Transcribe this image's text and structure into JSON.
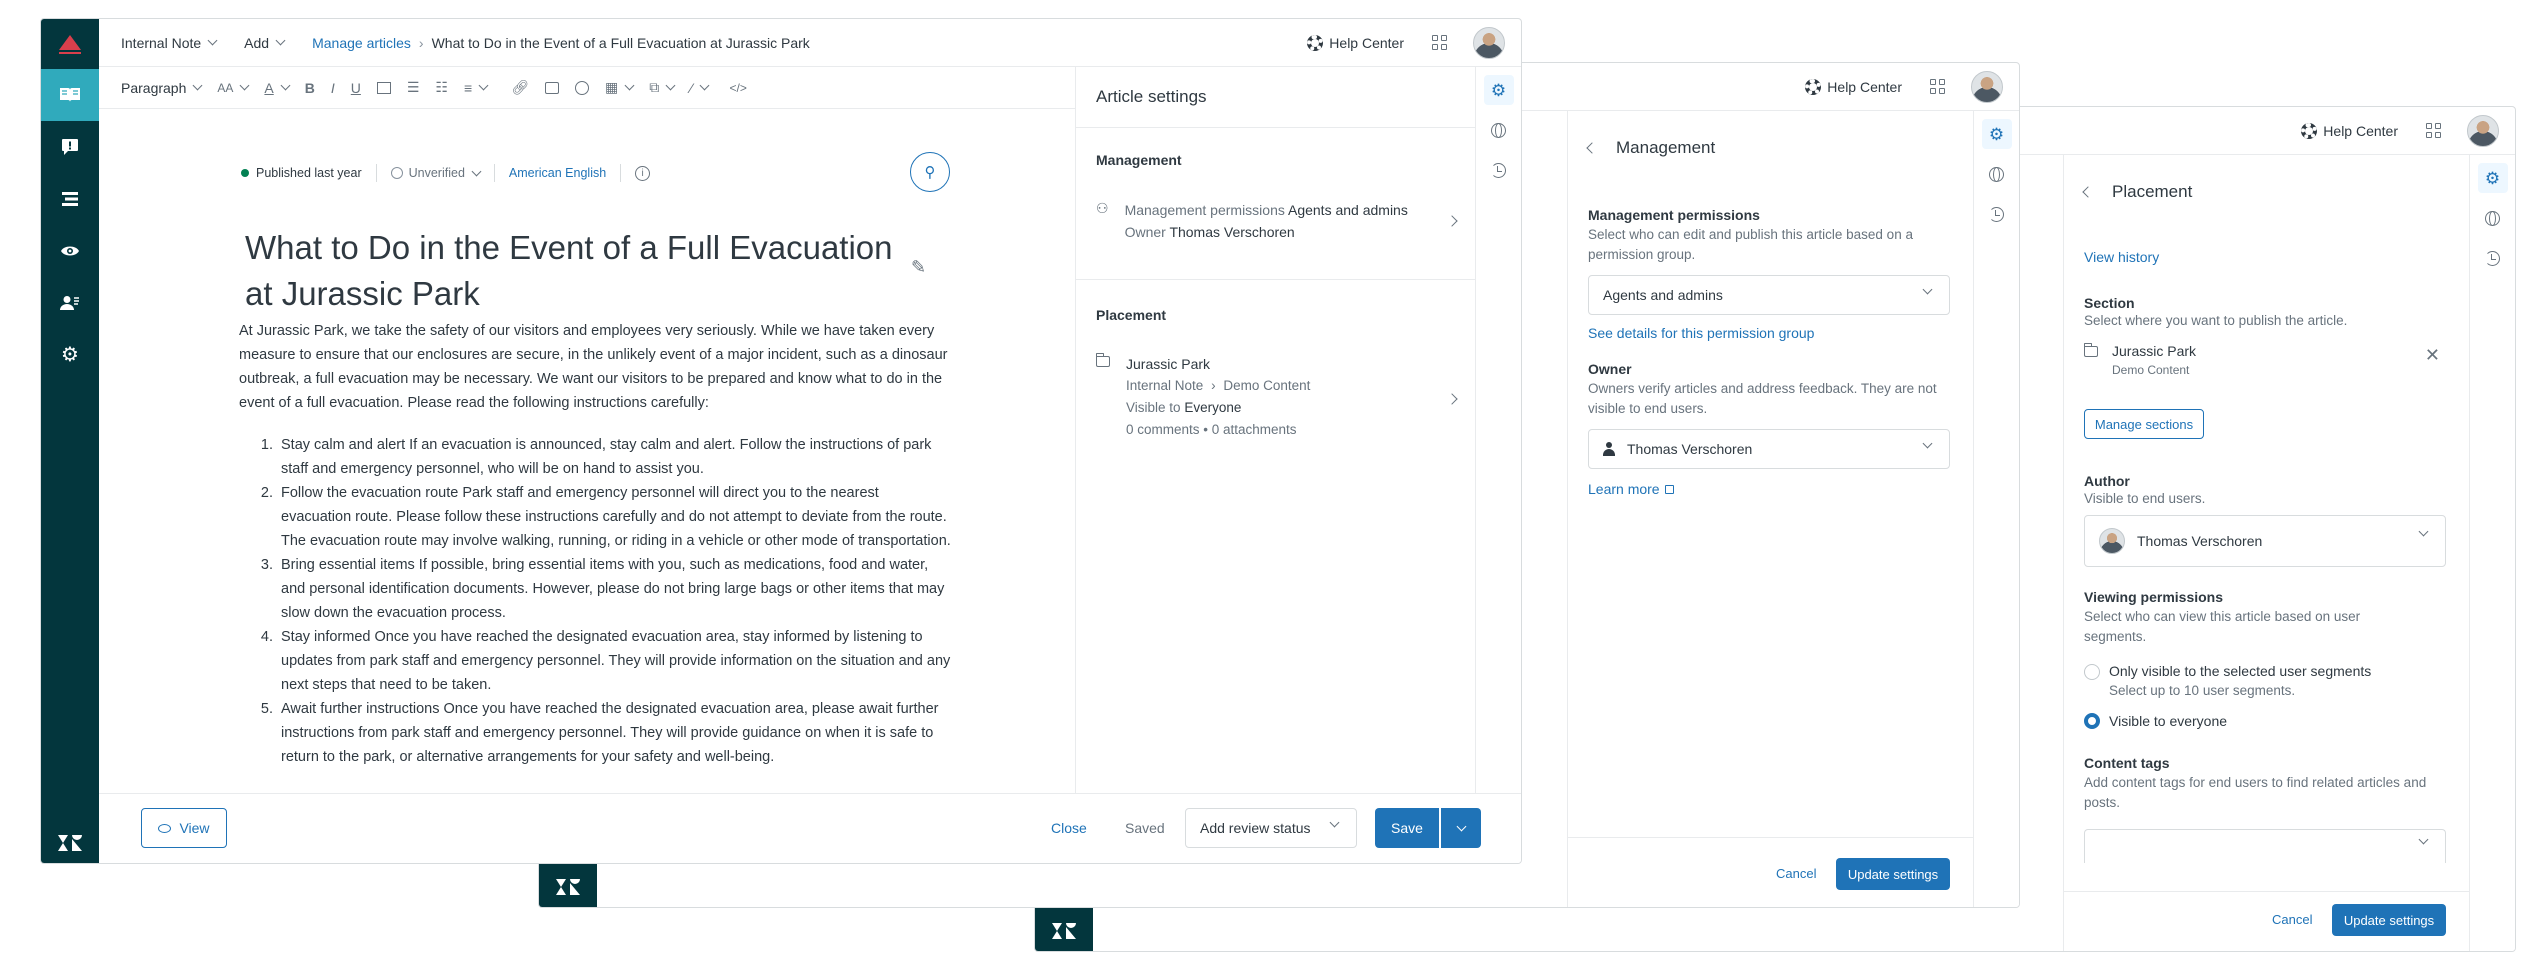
{
  "brand": {
    "primary": "#1f73b7",
    "rail": "#03363d",
    "rail_active": "#30aabc",
    "accent": "#d93f4c",
    "success": "#038153"
  },
  "topbar": {
    "internal_note": "Internal Note",
    "add": "Add",
    "manage_articles": "Manage articles",
    "breadcrumb_title": "What to Do in the Event of a Full Evacuation at Jurassic Park",
    "help_center": "Help Center"
  },
  "toolbar": {
    "paragraph": "Paragraph",
    "font_size": "AA",
    "font_color": "A",
    "bold": "B",
    "italic": "I",
    "underline": "U",
    "code": "</>"
  },
  "article": {
    "status": "Published last year",
    "verification": "Unverified",
    "locale": "American English",
    "title": "What to Do in the Event of a Full Evacuation at Jurassic Park",
    "intro": "At Jurassic Park, we take the safety of our visitors and employees very seriously. While we have taken every measure to ensure that our enclosures are secure, in the unlikely event of a major incident, such as a dinosaur outbreak, a full evacuation may be necessary. We want our visitors to be prepared and know what to do in the event of a full evacuation. Please read the following instructions carefully:",
    "steps": [
      "Stay calm and alert If an evacuation is announced, stay calm and alert. Follow the instructions of park staff and emergency personnel, who will be on hand to assist you.",
      "Follow the evacuation route Park staff and emergency personnel will direct you to the nearest evacuation route. Please follow these instructions carefully and do not attempt to deviate from the route. The evacuation route may involve walking, running, or riding in a vehicle or other mode of transportation.",
      "Bring essential items If possible, bring essential items with you, such as medications, food and water, and personal identification documents. However, please do not bring large bags or other items that may slow down the evacuation process.",
      "Stay informed Once you have reached the designated evacuation area, stay informed by listening to updates from park staff and emergency personnel. They will provide information on the situation and any next steps that need to be taken.",
      "Await further instructions Once you have reached the designated evacuation area, please await further instructions from park staff and emergency personnel. They will provide guidance on when it is safe to return to the park, or alternative arrangements for your safety and well-being."
    ]
  },
  "footer": {
    "view": "View",
    "close": "Close",
    "saved": "Saved",
    "review_status": "Add review status",
    "save": "Save"
  },
  "settings": {
    "title": "Article settings",
    "management_heading": "Management",
    "management_permissions_label": "Management permissions",
    "management_permissions_value": "Agents and admins",
    "owner_label": "Owner",
    "owner_value": "Thomas Verschoren",
    "placement_heading": "Placement",
    "section_name": "Jurassic Park",
    "path_a": "Internal Note",
    "path_b": "Demo Content",
    "visible_label": "Visible to",
    "visible_value": "Everyone",
    "counts": "0 comments • 0 attachments"
  },
  "management_panel": {
    "title": "Management",
    "perm_label": "Management permissions",
    "perm_hint": "Select who can edit and publish this article based on a permission group.",
    "perm_value": "Agents and admins",
    "perm_link": "See details for this permission group",
    "owner_label": "Owner",
    "owner_hint": "Owners verify articles and address feedback. They are not visible to end users.",
    "owner_value": "Thomas Verschoren",
    "learn_more": "Learn more",
    "cancel": "Cancel",
    "update": "Update settings"
  },
  "placement_panel": {
    "title": "Placement",
    "view_history": "View history",
    "section_label": "Section",
    "section_hint": "Select where you want to publish the article.",
    "section_name": "Jurassic Park",
    "section_sub": "Demo Content",
    "manage_sections": "Manage sections",
    "author_label": "Author",
    "author_hint": "Visible to end users.",
    "author_value": "Thomas Verschoren",
    "viewing_label": "Viewing permissions",
    "viewing_hint": "Select who can view this article based on user segments.",
    "opt1": "Only visible to the selected user segments",
    "opt1_hint": "Select up to 10 user segments.",
    "opt2": "Visible to everyone",
    "tags_label": "Content tags",
    "tags_hint": "Add content tags for end users to find related articles and posts.",
    "cancel": "Cancel",
    "update": "Update settings"
  }
}
